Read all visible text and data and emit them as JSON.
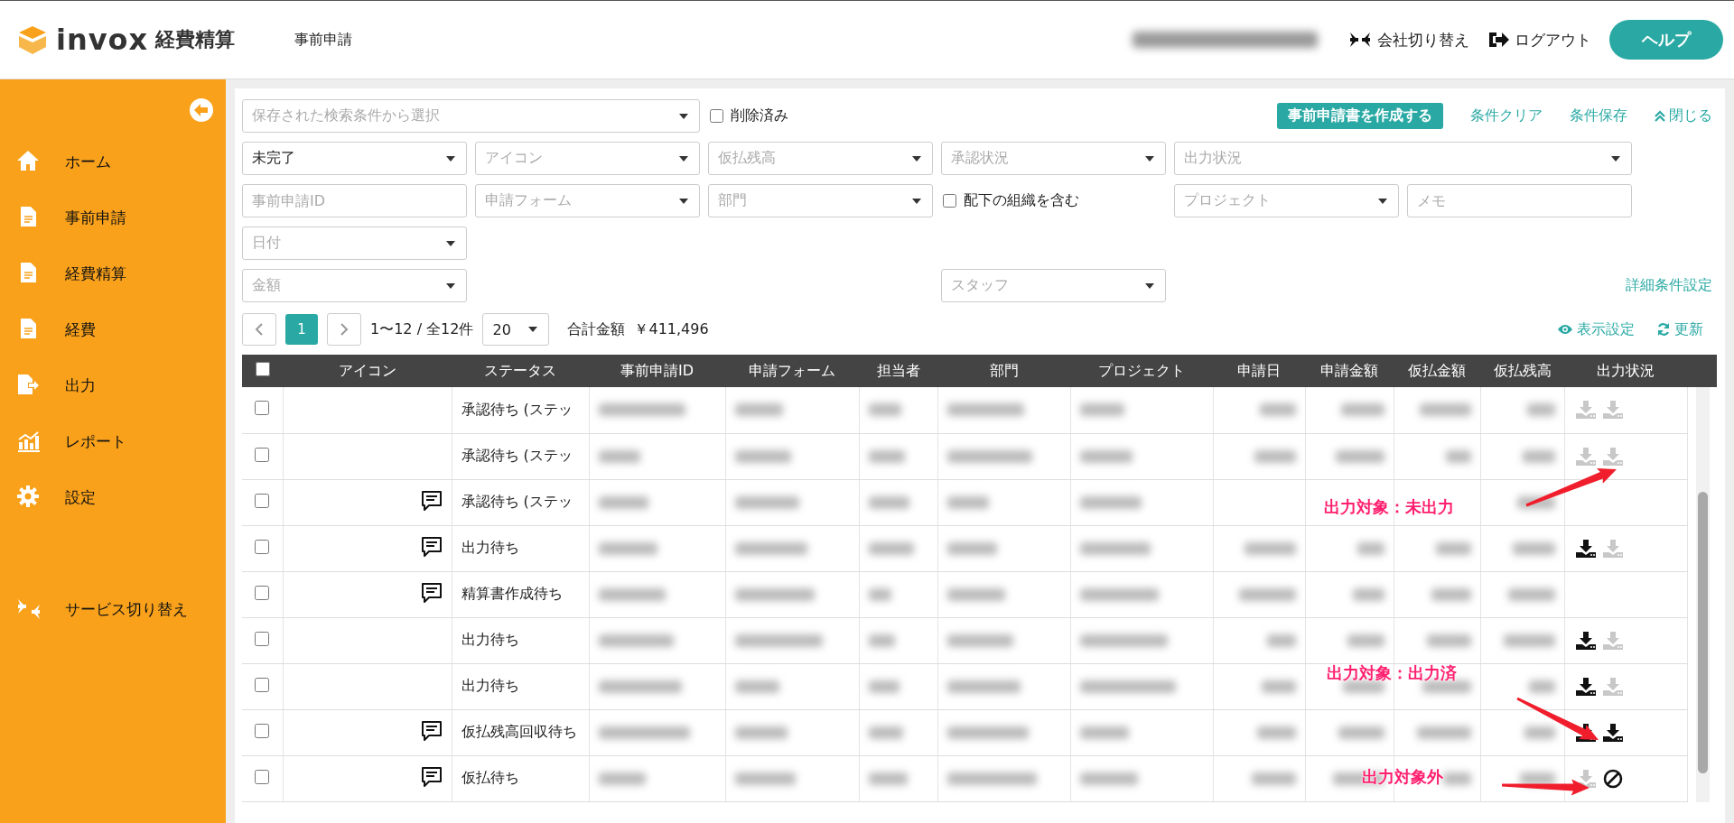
{
  "header": {
    "logo_text": "invox",
    "logo_subtitle": "経費精算",
    "page_title": "事前申請",
    "switch_company": "会社切り替え",
    "logout": "ログアウト",
    "help": "ヘルプ"
  },
  "sidebar": {
    "items": [
      {
        "label": "ホーム",
        "kind": "home"
      },
      {
        "label": "事前申請",
        "kind": "document"
      },
      {
        "label": "経費精算",
        "kind": "document"
      },
      {
        "label": "経費",
        "kind": "document"
      },
      {
        "label": "出力",
        "kind": "export"
      },
      {
        "label": "レポート",
        "kind": "report"
      },
      {
        "label": "設定",
        "kind": "settings"
      },
      {
        "label": "サービス切り替え",
        "kind": "switch"
      }
    ]
  },
  "filters": {
    "saved_search": {
      "placeholder": "保存された検索条件から選択"
    },
    "deleted": {
      "label": "削除済み",
      "checked": false
    },
    "create_button": "事前申請書を作成する",
    "clear": "条件クリア",
    "save": "条件保存",
    "close": "閉じる",
    "advanced": "詳細条件設定",
    "fields": [
      {
        "kind": "select",
        "value": "未完了"
      },
      {
        "kind": "select",
        "placeholder": "アイコン"
      },
      {
        "kind": "select",
        "placeholder": "仮払残高"
      },
      {
        "kind": "select",
        "placeholder": "承認状況"
      },
      {
        "kind": "select",
        "placeholder": "出力状況"
      },
      {
        "kind": "text",
        "placeholder": "事前申請ID"
      },
      {
        "kind": "select",
        "placeholder": "申請フォーム"
      },
      {
        "kind": "select",
        "placeholder": "部門"
      },
      {
        "kind": "checkbox",
        "label": "配下の組織を含む",
        "checked": false
      },
      {
        "kind": "select",
        "placeholder": "プロジェクト"
      },
      {
        "kind": "text",
        "placeholder": "メモ"
      },
      {
        "kind": "select",
        "placeholder": "日付"
      },
      {
        "kind": "select",
        "placeholder": "金額"
      },
      {
        "kind": "select",
        "placeholder": "スタッフ"
      }
    ]
  },
  "pagination": {
    "pages": [
      {
        "label": "1",
        "selected": true
      }
    ],
    "range": "1〜12 / 全12件",
    "page_size": "20",
    "total_label": "合計金額",
    "total": "￥411,496",
    "display_settings": "表示設定",
    "refresh": "更新"
  },
  "table": {
    "select_all_checked": false,
    "columns": [
      "アイコン",
      "ステータス",
      "事前申請ID",
      "申請フォーム",
      "担当者",
      "部門",
      "プロジェクト",
      "申請日",
      "申請金額",
      "仮払金額",
      "仮払残高",
      "出力状況"
    ],
    "rows": [
      {
        "checked": false,
        "memo": false,
        "status": "承認待ち (ステッ",
        "outputs": [
          {
            "kind": "unavailable"
          },
          {
            "kind": "unavailable"
          }
        ]
      },
      {
        "checked": false,
        "memo": false,
        "status": "承認待ち (ステッ",
        "outputs": [
          {
            "kind": "unavailable"
          },
          {
            "kind": "unavailable"
          }
        ]
      },
      {
        "checked": false,
        "memo": true,
        "status": "承認待ち (ステッ",
        "outputs": []
      },
      {
        "checked": false,
        "memo": true,
        "status": "出力待ち",
        "outputs": [
          {
            "kind": "available"
          },
          {
            "kind": "unavailable"
          }
        ]
      },
      {
        "checked": false,
        "memo": true,
        "status": "精算書作成待ち",
        "outputs": []
      },
      {
        "checked": false,
        "memo": false,
        "status": "出力待ち",
        "outputs": [
          {
            "kind": "available"
          },
          {
            "kind": "unavailable"
          }
        ]
      },
      {
        "checked": false,
        "memo": false,
        "status": "出力待ち",
        "outputs": [
          {
            "kind": "available"
          },
          {
            "kind": "unavailable"
          }
        ]
      },
      {
        "checked": false,
        "memo": true,
        "status": "仮払残高回収待ち",
        "outputs": [
          {
            "kind": "available"
          },
          {
            "kind": "available"
          }
        ]
      },
      {
        "checked": false,
        "memo": true,
        "status": "仮払待ち",
        "outputs": [
          {
            "kind": "unavailable"
          },
          {
            "kind": "prohibited"
          }
        ]
      }
    ]
  },
  "annotations": [
    {
      "text": "出力対象：未出力"
    },
    {
      "text": "出力対象：出力済"
    },
    {
      "text": "出力対象外"
    }
  ]
}
